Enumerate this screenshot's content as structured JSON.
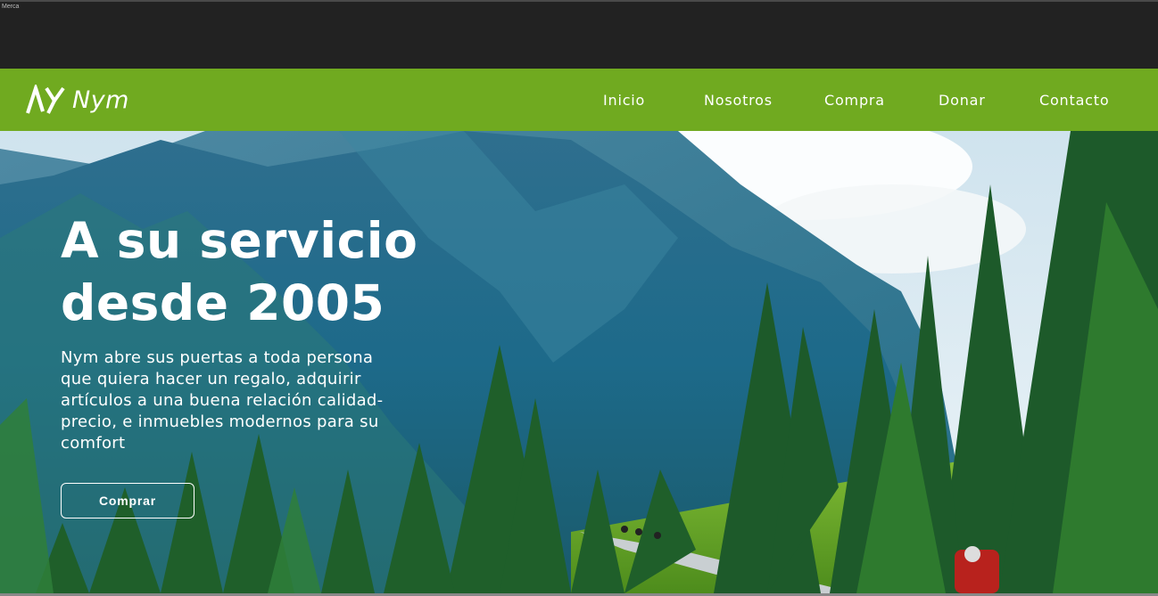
{
  "window": {
    "tiny_label": "Merca"
  },
  "brand": {
    "name": "Nym",
    "logo_icon": "ny-logo-icon"
  },
  "nav": {
    "items": [
      {
        "label": "Inicio"
      },
      {
        "label": "Nosotros"
      },
      {
        "label": "Compra"
      },
      {
        "label": "Donar"
      },
      {
        "label": "Contacto"
      }
    ]
  },
  "hero": {
    "title_line1": "A su servicio",
    "title_line2": "desde 2005",
    "paragraph": "Nym abre sus puertas a toda persona que quiera hacer un regalo, adquirir artículos a una buena relación calidad-precio, e inmuebles modernos para su comfort",
    "cta_label": "Comprar",
    "background": "mountain-forest-road-photo"
  },
  "colors": {
    "nav_bg": "#70aa20",
    "chrome_bg": "#222222",
    "text": "#ffffff"
  }
}
